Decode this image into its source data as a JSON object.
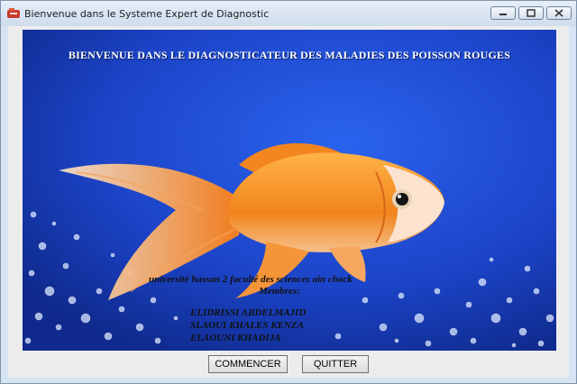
{
  "window": {
    "title": "Bienvenue dans le Systeme Expert de Diagnostic"
  },
  "banner": {
    "title": "BIENVENUE DANS LE DIAGNOSTICATEUR DES MALADIES DES POISSON ROUGES",
    "university": "université hassan 2 faculté des sciences ain chock",
    "members_heading": "Membres:",
    "members": [
      "ELIDRISSI ABDELMAJID",
      "SLAOUI KHALES KENZA",
      "ELAOUNI KHADIJA"
    ]
  },
  "buttons": {
    "start": "COMMENCER",
    "quit": "QUITTER"
  },
  "colors": {
    "water": "#1f4ad6",
    "fish": "#f08a1e",
    "chrome": "#d6e3f2"
  }
}
